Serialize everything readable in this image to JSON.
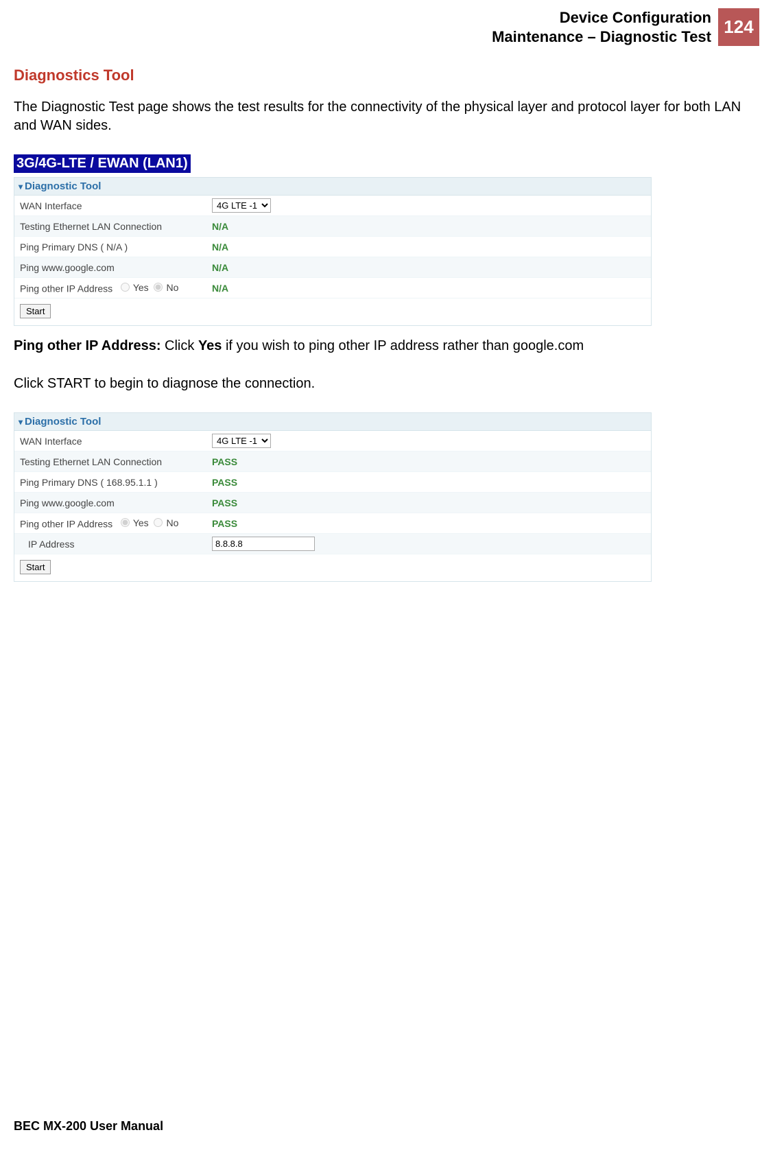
{
  "header": {
    "line1": "Device Configuration",
    "line2": "Maintenance – Diagnostic Test",
    "page_number": "124"
  },
  "section_title": "Diagnostics Tool",
  "intro_text": "The Diagnostic Test page shows the test results for the connectivity of the physical layer and protocol layer for both LAN and WAN sides.",
  "bluebar": "3G/4G-LTE / EWAN (LAN1)",
  "panel1": {
    "title": "Diagnostic Tool",
    "wan_label": "WAN Interface",
    "wan_value": "4G LTE -1",
    "rows": [
      {
        "label": "Testing Ethernet LAN Connection",
        "value": "N/A"
      },
      {
        "label": "Ping Primary DNS ( N/A )",
        "value": "N/A"
      },
      {
        "label": "Ping www.google.com",
        "value": "N/A"
      }
    ],
    "ping_other_label": "Ping other IP Address",
    "yes": "Yes",
    "no": "No",
    "ping_other_value": "N/A",
    "start": "Start"
  },
  "note_bold1": "Ping other IP Address:",
  "note_text1a": " Click ",
  "note_bold2": "Yes",
  "note_text1b": " if you wish to ping other IP address rather than google.com",
  "note_text2": "Click START to begin to diagnose the connection.",
  "panel2": {
    "title": "Diagnostic Tool",
    "wan_label": "WAN Interface",
    "wan_value": "4G LTE -1",
    "rows": [
      {
        "label": "Testing Ethernet LAN Connection",
        "value": "PASS"
      },
      {
        "label": "Ping Primary DNS ( 168.95.1.1 )",
        "value": "PASS"
      },
      {
        "label": "Ping www.google.com",
        "value": "PASS"
      }
    ],
    "ping_other_label": "Ping other IP Address",
    "yes": "Yes",
    "no": "No",
    "ping_other_value": "PASS",
    "ip_label": "IP Address",
    "ip_value": "8.8.8.8",
    "start": "Start"
  },
  "footer": "BEC MX-200 User Manual"
}
